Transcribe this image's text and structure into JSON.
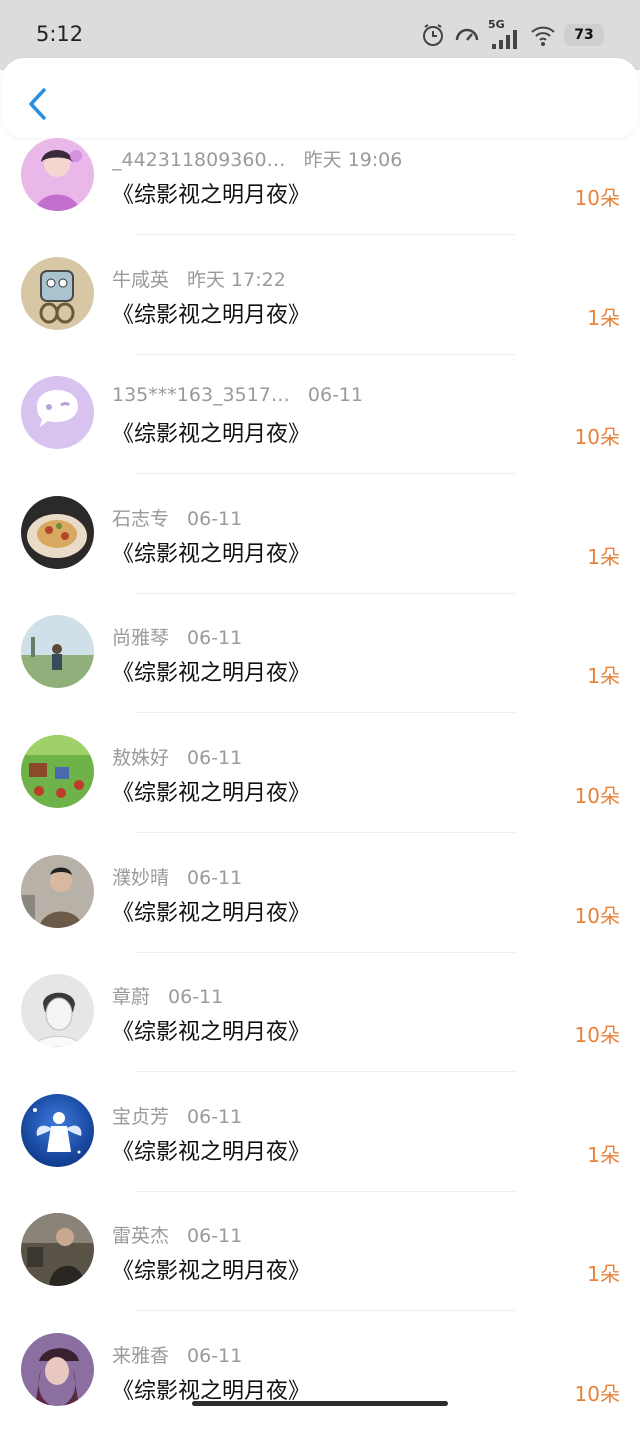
{
  "status": {
    "time": "5:12",
    "network": "5G",
    "battery": "73"
  },
  "colors": {
    "accent": "#e8823a",
    "back": "#2a8fe0"
  },
  "items": [
    {
      "name": "_442311809360…",
      "date": "昨天 19:06",
      "title": "《综影视之明月夜》",
      "count": "10朵",
      "avatar": "photo-woman-purple"
    },
    {
      "name": "牛咸英",
      "date": "昨天 17:22",
      "title": "《综影视之明月夜》",
      "count": "1朵",
      "avatar": "cartoon-icon"
    },
    {
      "name": "135***163_3517…",
      "date": "06-11",
      "title": "《综影视之明月夜》",
      "count": "10朵",
      "avatar": "chat-icon"
    },
    {
      "name": "石志专",
      "date": "06-11",
      "title": "《综影视之明月夜》",
      "count": "1朵",
      "avatar": "photo-food"
    },
    {
      "name": "尚雅琴",
      "date": "06-11",
      "title": "《综影视之明月夜》",
      "count": "1朵",
      "avatar": "photo-field"
    },
    {
      "name": "敖姝好",
      "date": "06-11",
      "title": "《综影视之明月夜》",
      "count": "10朵",
      "avatar": "game-farm"
    },
    {
      "name": "濮妙晴",
      "date": "06-11",
      "title": "《综影视之明月夜》",
      "count": "10朵",
      "avatar": "photo-man"
    },
    {
      "name": "章蔚",
      "date": "06-11",
      "title": "《综影视之明月夜》",
      "count": "10朵",
      "avatar": "photo-bw-face"
    },
    {
      "name": "宝贞芳",
      "date": "06-11",
      "title": "《综影视之明月夜》",
      "count": "1朵",
      "avatar": "angel-blue"
    },
    {
      "name": "雷英杰",
      "date": "06-11",
      "title": "《综影视之明月夜》",
      "count": "1朵",
      "avatar": "photo-dark-man"
    },
    {
      "name": "来雅香",
      "date": "06-11",
      "title": "《综影视之明月夜》",
      "count": "10朵",
      "avatar": "photo-woman-hat"
    }
  ]
}
